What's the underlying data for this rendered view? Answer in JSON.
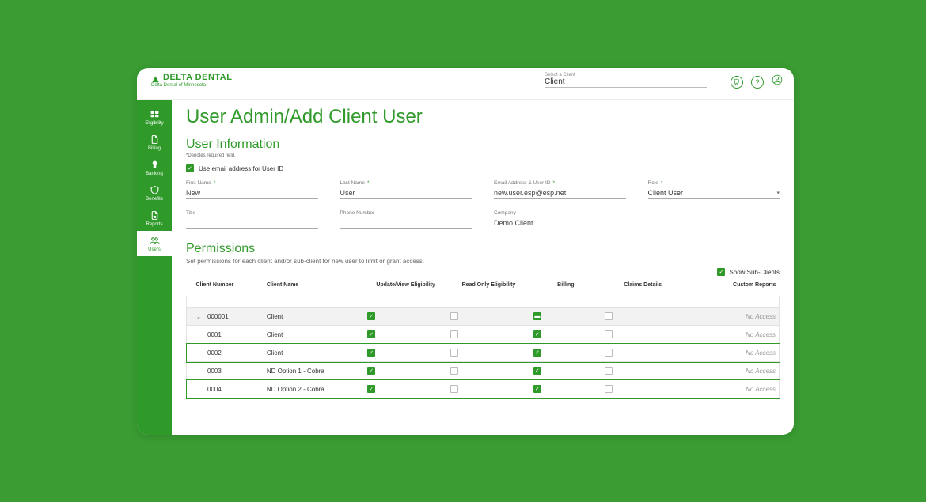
{
  "brand": {
    "name": "DELTA DENTAL",
    "sub": "Delta Dental of Minnesota"
  },
  "topbar": {
    "client_select_label": "Select a Client",
    "client_select_value": "Client"
  },
  "sidebar": {
    "items": [
      {
        "key": "eligibility",
        "label": "Eligibility"
      },
      {
        "key": "billing",
        "label": "Billing"
      },
      {
        "key": "banking",
        "label": "Banking"
      },
      {
        "key": "benefits",
        "label": "Benefits"
      },
      {
        "key": "reports",
        "label": "Reports"
      },
      {
        "key": "users",
        "label": "Users"
      }
    ]
  },
  "page": {
    "title": "User Admin/Add Client User"
  },
  "user_info": {
    "section_title": "User Information",
    "required_note": "*Denotes required field.",
    "use_email_label": "Use email address for User ID",
    "fields": {
      "first_name": {
        "label": "First Name",
        "value": "New",
        "required": true
      },
      "last_name": {
        "label": "Last Name",
        "value": "User",
        "required": true
      },
      "email": {
        "label": "Email Address & User ID",
        "value": "new.user.esp@esp.net",
        "required": true
      },
      "role": {
        "label": "Role",
        "value": "Client User",
        "required": true
      },
      "title": {
        "label": "Title",
        "value": ""
      },
      "phone": {
        "label": "Phone Number",
        "value": ""
      },
      "company": {
        "label": "Company",
        "value": "Demo Client"
      }
    }
  },
  "permissions": {
    "section_title": "Permissions",
    "description": "Set permissions for each client and/or sub-client for new user to limit or grant access.",
    "show_sub_label": "Show Sub-Clients",
    "columns": {
      "client_number": "Client Number",
      "client_name": "Client Name",
      "update_view": "Update/View Eligibility",
      "read_only": "Read Only Eligibility",
      "billing": "Billing",
      "claims": "Claims Details",
      "custom": "Custom Reports"
    },
    "no_access_text": "No Access",
    "rows": [
      {
        "number": "000001",
        "name": "Client",
        "parent": true,
        "highlight": false,
        "update": "checked",
        "readonly": "empty",
        "billing": "indeterminate",
        "claims": "empty"
      },
      {
        "number": "0001",
        "name": "Client",
        "parent": false,
        "highlight": false,
        "update": "checked",
        "readonly": "empty",
        "billing": "checked",
        "claims": "empty"
      },
      {
        "number": "0002",
        "name": "Client",
        "parent": false,
        "highlight": true,
        "update": "checked",
        "readonly": "empty",
        "billing": "checked",
        "claims": "empty"
      },
      {
        "number": "0003",
        "name": "ND Option 1 - Cobra",
        "parent": false,
        "highlight": false,
        "update": "checked",
        "readonly": "empty",
        "billing": "checked",
        "claims": "empty"
      },
      {
        "number": "0004",
        "name": "ND Option 2 - Cobra",
        "parent": false,
        "highlight": true,
        "update": "checked",
        "readonly": "empty",
        "billing": "checked",
        "claims": "empty"
      }
    ]
  }
}
